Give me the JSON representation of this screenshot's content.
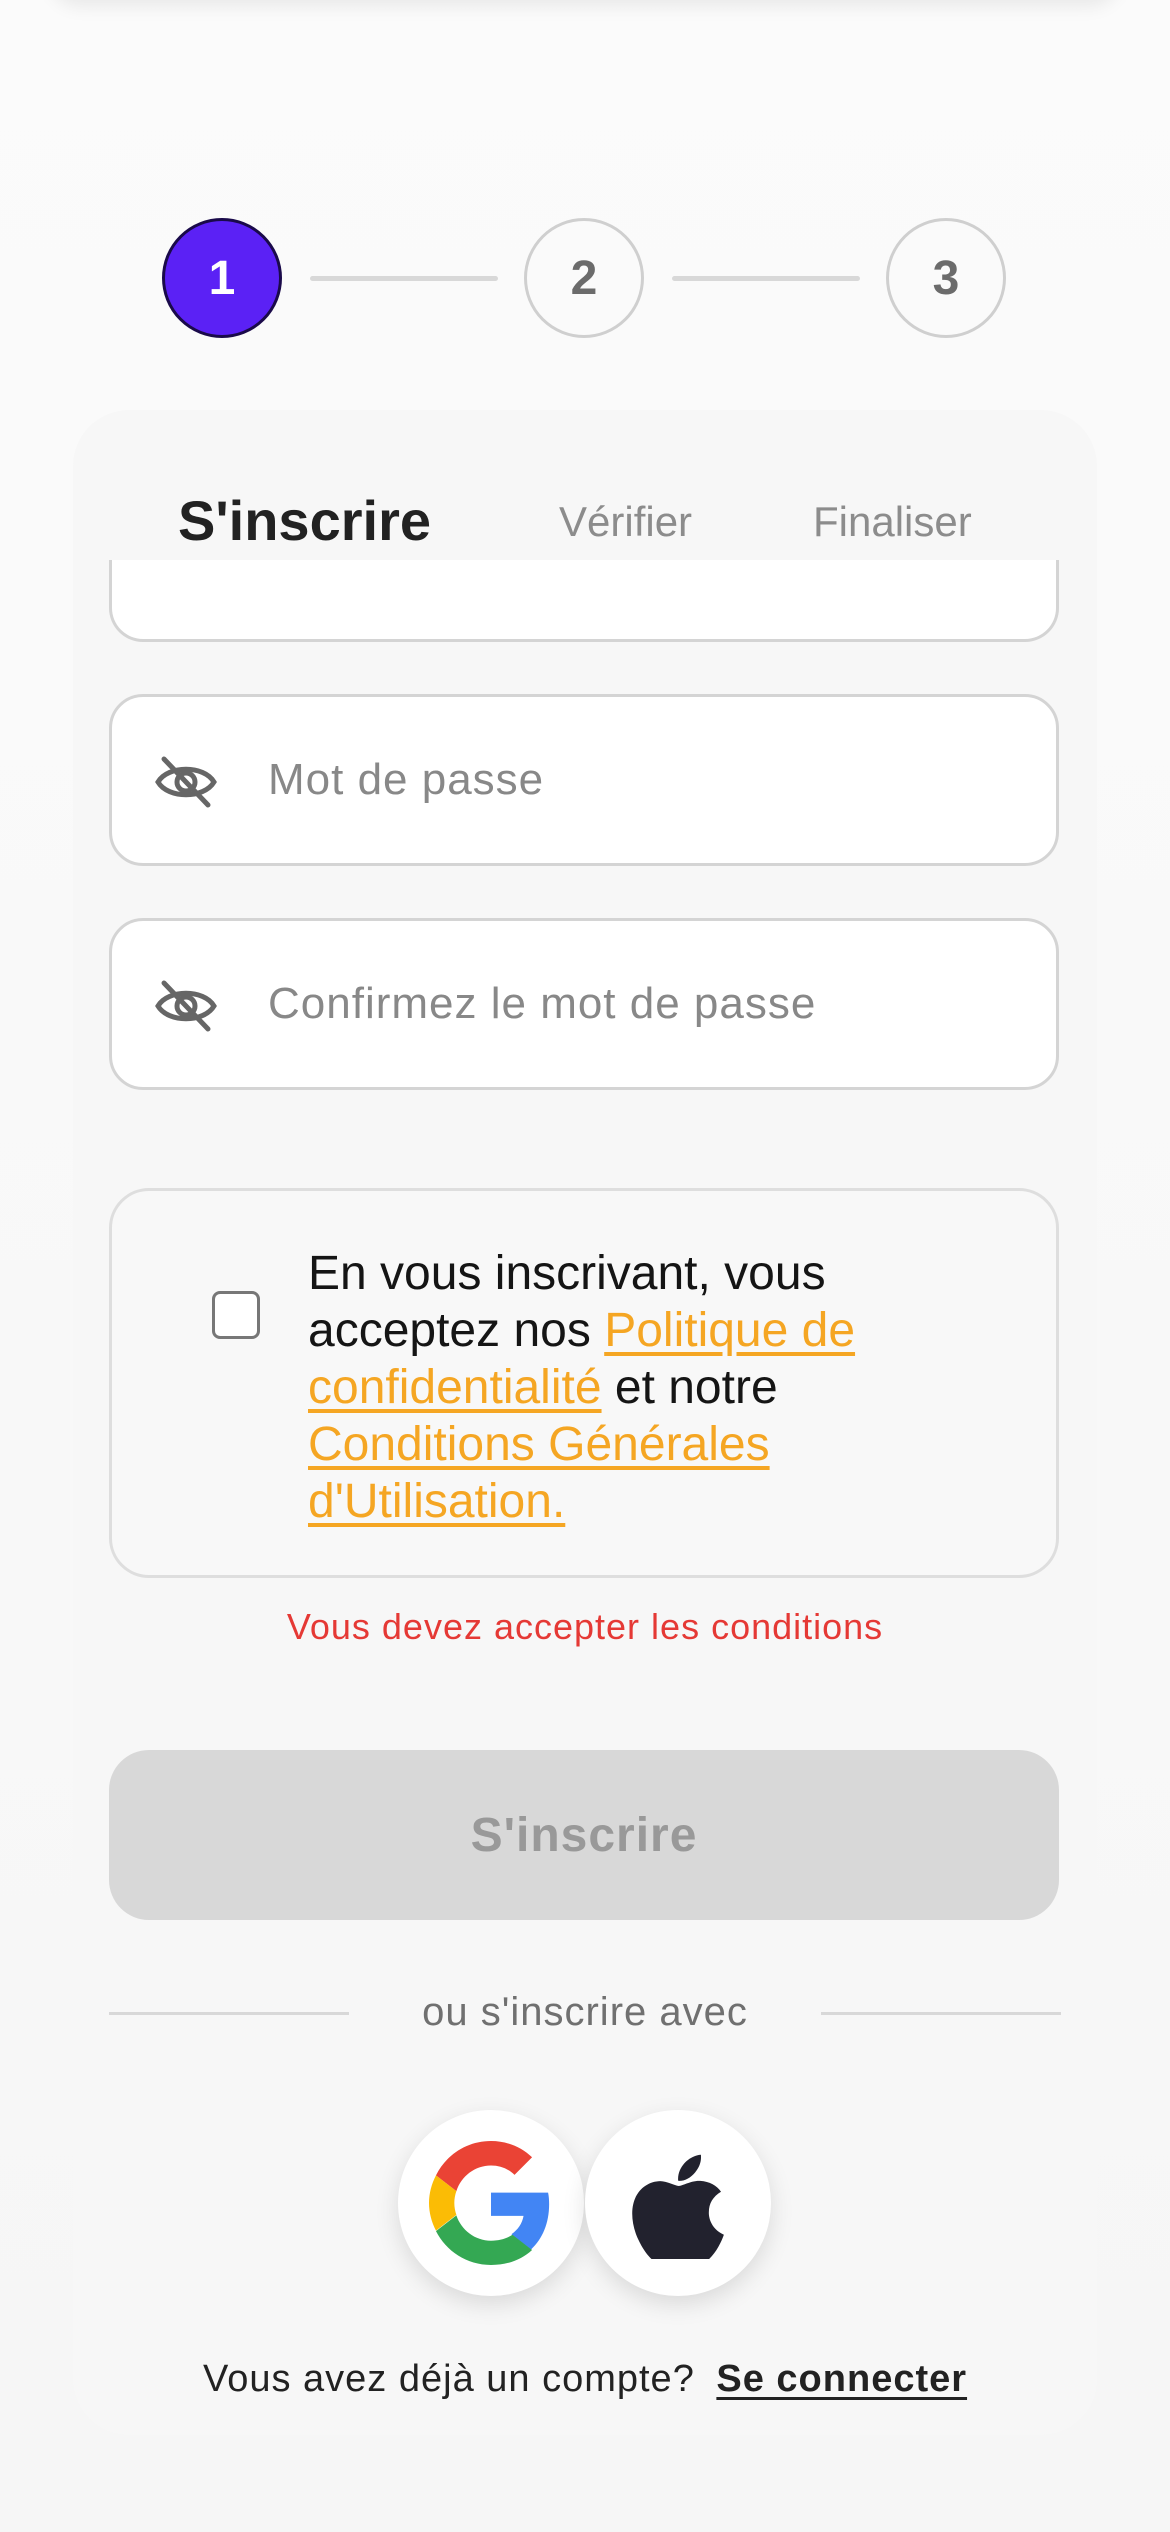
{
  "stepper": {
    "steps": [
      "1",
      "2",
      "3"
    ],
    "active_step": 1,
    "accent_color": "#5b21f5"
  },
  "tabs": {
    "signup": "S'inscrire",
    "verify": "Vérifier",
    "finalize": "Finaliser"
  },
  "form": {
    "password_placeholder": "Mot de passe",
    "confirm_password_placeholder": "Confirmez le mot de passe",
    "visibility_icon": "eye-off-icon"
  },
  "terms": {
    "checked": false,
    "text_1": "En vous inscrivant, vous acceptez nos ",
    "privacy_link": "Politique de confidentialité",
    "text_2": " et notre ",
    "cgu_link": "Conditions Générales d'Utilisation.",
    "link_color": "#f5a623"
  },
  "error_message": "Vous devez accepter les conditions",
  "submit_label": "S'inscrire",
  "divider_text": "ou s'inscrire avec",
  "social": {
    "google_icon": "google-icon",
    "apple_icon": "apple-icon"
  },
  "footer": {
    "question": "Vous avez déjà un compte?",
    "login_link": "Se connecter"
  }
}
